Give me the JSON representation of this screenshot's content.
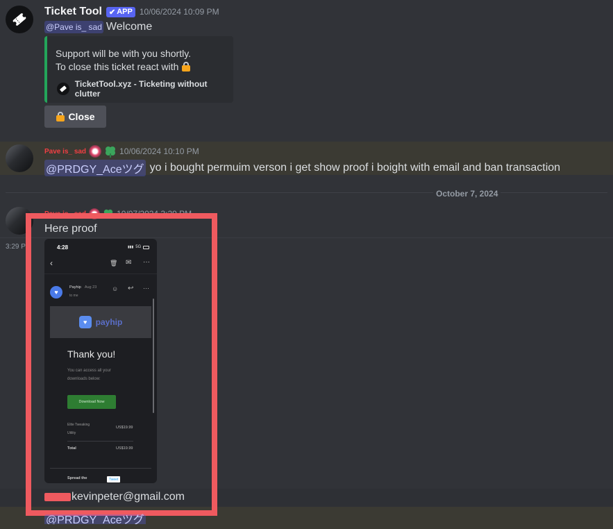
{
  "bot_message": {
    "username": "Ticket Tool",
    "badge": "APP",
    "badge_check": "✔",
    "timestamp": "10/06/2024 10:09 PM",
    "mention": "@Pave is_ sad",
    "text": "Welcome",
    "embed": {
      "line1": "Support will be with you shortly.",
      "line2": "To close this ticket react with",
      "footer": "TicketTool.xyz - Ticketing without clutter"
    },
    "close_button": "Close"
  },
  "user_message": {
    "username": "Pave is_ sad",
    "timestamp": "10/06/2024 10:10 PM",
    "mention": "@PRDGY_Aceツグ",
    "text": "yo i bought permuim verson i get show proof i boight with email and ban transaction"
  },
  "date_divider": "October 7, 2024",
  "second_message": {
    "username": "Pave is_ sad",
    "timestamp": "10/07/2024 3:29 PM",
    "side_time": "3:29 P",
    "text": "Here proof",
    "email_text": "kevinpeter@gmail.com",
    "trailing_mention": "@PRDGY_Aceツグ"
  },
  "proof_image": {
    "status_time": "4:28",
    "status_signal": "5G",
    "sender": "Payhip",
    "sender_date": "Aug 23",
    "recipient": "to me",
    "brand": "payhip",
    "thank_you": "Thank you!",
    "access_text_1": "You can access all your",
    "access_text_2": "downloads below:",
    "download_button": "Download Now",
    "product_name_1": "Elite Tweaking",
    "product_name_2": "Utility",
    "product_price": "US$19.99",
    "total_label": "Total",
    "total_price": "US$19.99",
    "bottom_label": "Spread the",
    "bottom_tag": "Tweet"
  },
  "colors": {
    "background": "#313338",
    "accent": "#5865f2",
    "embed_border": "#23a55a",
    "highlight": "#ef5a5f",
    "username_red": "#f23f43"
  }
}
